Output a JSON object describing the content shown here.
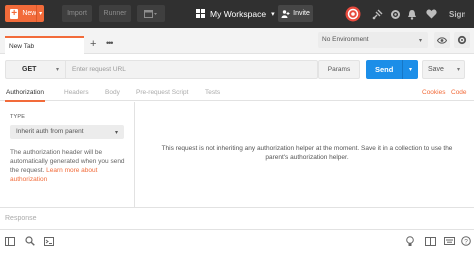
{
  "topbar": {
    "new_label": "New",
    "import_label": "Import",
    "runner_label": "Runner",
    "workspace_label": "My Workspace",
    "invite_label": "Invite"
  },
  "tabs": {
    "active_tab": "New Tab",
    "plus": "+",
    "more": "•••"
  },
  "environment": {
    "selected": "No Environment"
  },
  "request": {
    "method": "GET",
    "url_placeholder": "Enter request URL",
    "params_label": "Params",
    "send_label": "Send",
    "save_label": "Save"
  },
  "subtabs": {
    "items": [
      "Authorization",
      "Headers",
      "Body",
      "Pre-request Script",
      "Tests"
    ],
    "cookies": "Cookies",
    "code": "Code"
  },
  "auth": {
    "type_label": "TYPE",
    "type_value": "Inherit auth from parent",
    "description": "The authorization header will be automatically generated when you send the request.",
    "learn_more": "Learn more about authorization",
    "message": "This request is not inheriting any authorization helper at the moment. Save it in a collection to use the parent's authorization helper."
  },
  "response": {
    "label": "Response"
  },
  "colors": {
    "accent": "#f26b3a",
    "send": "#1c8ee8",
    "topbar": "#303030"
  }
}
